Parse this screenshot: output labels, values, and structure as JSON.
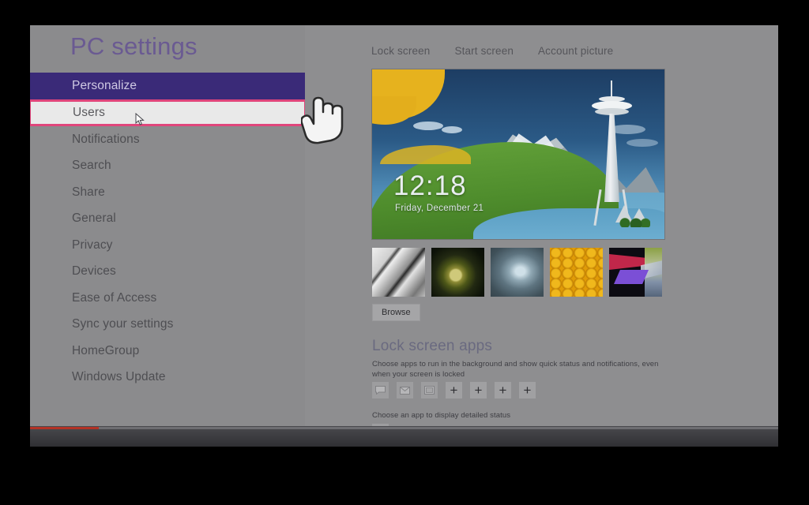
{
  "app": {
    "title": "PC settings"
  },
  "sidebar": {
    "items": [
      {
        "label": "Personalize",
        "state": "selected"
      },
      {
        "label": "Users",
        "state": "highlighted"
      },
      {
        "label": "Notifications",
        "state": "normal"
      },
      {
        "label": "Search",
        "state": "normal"
      },
      {
        "label": "Share",
        "state": "normal"
      },
      {
        "label": "General",
        "state": "normal"
      },
      {
        "label": "Privacy",
        "state": "normal"
      },
      {
        "label": "Devices",
        "state": "normal"
      },
      {
        "label": "Ease of Access",
        "state": "normal"
      },
      {
        "label": "Sync your settings",
        "state": "normal"
      },
      {
        "label": "HomeGroup",
        "state": "normal"
      },
      {
        "label": "Windows Update",
        "state": "normal"
      }
    ]
  },
  "content": {
    "tabs": [
      {
        "label": "Lock screen",
        "active": true
      },
      {
        "label": "Start screen",
        "active": false
      },
      {
        "label": "Account picture",
        "active": false
      }
    ],
    "lock_screen_preview": {
      "time": "12:18",
      "date": "Friday, December 21",
      "scene": "space-needle-mountain-illustration"
    },
    "thumbnails": [
      {
        "name": "piano-keys-thumbnail"
      },
      {
        "name": "nautilus-shell-thumbnail"
      },
      {
        "name": "tunnel-thumbnail"
      },
      {
        "name": "honeycomb-thumbnail"
      },
      {
        "name": "abstract-geometric-thumbnail"
      }
    ],
    "browse_button": "Browse",
    "lock_screen_apps": {
      "heading": "Lock screen apps",
      "description": "Choose apps to run in the background and show quick status and notifications, even when your screen is locked",
      "app_tiles": [
        {
          "icon": "chat-icon"
        },
        {
          "icon": "mail-icon"
        },
        {
          "icon": "calendar-icon"
        },
        {
          "icon": "plus-icon",
          "glyph": "+"
        },
        {
          "icon": "plus-icon",
          "glyph": "+"
        },
        {
          "icon": "plus-icon",
          "glyph": "+"
        },
        {
          "icon": "plus-icon",
          "glyph": "+"
        }
      ],
      "detailed_status_label": "Choose an app to display detailed status"
    }
  },
  "colors": {
    "accent_purple": "#3a2a78",
    "title_purple": "#6a5a92",
    "highlight_pink": "#e0457b",
    "sidebar_gray": "#8b8b8d",
    "content_gray": "#8e8e90",
    "progress_red": "#b33225"
  }
}
